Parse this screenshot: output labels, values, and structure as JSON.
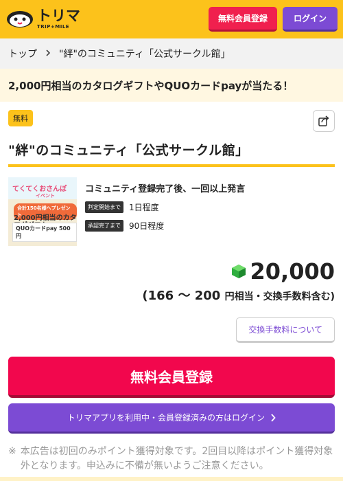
{
  "header": {
    "logo_text": "トリマ",
    "logo_sub": "TRIP+MILE",
    "register_label": "無料会員登録",
    "login_label": "ログイン"
  },
  "breadcrumb": {
    "home": "トップ",
    "current": "\"絆\"のコミュニティ「公式サークル館」"
  },
  "promo": {
    "text": "2,000円相当のカタログギフトやQUOカードpayが当たる！"
  },
  "offer": {
    "badge": "無料",
    "title": "\"絆\"のコミュニティ「公式サークル館」",
    "thumbnail": {
      "title": "てくてくおさんぽ",
      "sub": "イベント",
      "pill": "合計150名様へプレゼント",
      "gift": "2,000円相当のカタログギフト",
      "quo": "QUOカードpay 500円"
    },
    "condition": "コミュニティ登録完了後、一回以上発言",
    "periods": [
      {
        "tag": "判定開始まで",
        "value": "1日程度"
      },
      {
        "tag": "承認完了まで",
        "value": "90日程度"
      }
    ],
    "points": "20,000",
    "yen_range": "(166 〜 200",
    "yen_suffix": "円相当・交換手数料含む)",
    "fee_button": "交換手数料について",
    "register_button": "無料会員登録",
    "app_login_button": "トリマアプリを利用中・会員登録済みの方はログイン",
    "note_mark": "※",
    "note": "本広告は初回のみポイント獲得対象です。2回目以降はポイント獲得対象外となります。申込みに不備が無いようご注意ください。"
  },
  "colors": {
    "brand_yellow": "#fcc21b",
    "register_red": "#f2074d",
    "login_purple": "#7c4bd4"
  }
}
